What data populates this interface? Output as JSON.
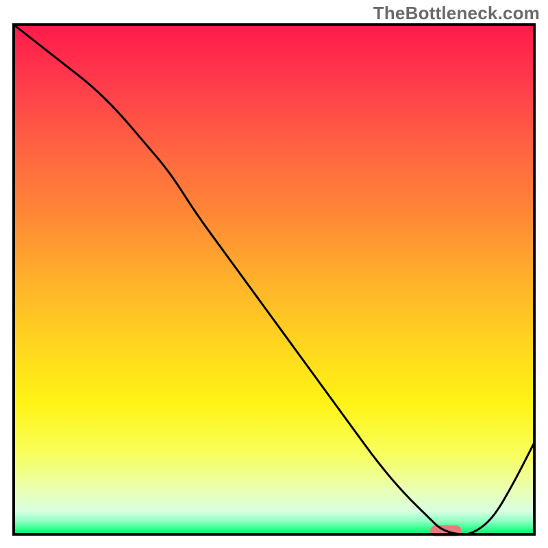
{
  "watermark": "TheBottleneck.com",
  "chart_data": {
    "type": "line",
    "title": "",
    "xlabel": "",
    "ylabel": "",
    "xlim": [
      0,
      100
    ],
    "ylim": [
      0,
      100
    ],
    "series": [
      {
        "name": "bottleneck-curve",
        "x": [
          0,
          5,
          10,
          15,
          20,
          25,
          30,
          35,
          40,
          45,
          50,
          55,
          60,
          65,
          70,
          75,
          80,
          82,
          85,
          88,
          92,
          96,
          100
        ],
        "values": [
          100,
          96,
          92,
          88,
          83,
          77,
          71,
          63,
          56,
          49,
          42,
          35,
          28,
          21,
          14,
          8,
          3,
          1,
          0,
          0,
          3,
          10,
          18
        ]
      }
    ],
    "marker": {
      "x_start": 80,
      "x_end": 86,
      "y": 0,
      "color": "#e67a7d"
    },
    "gradient_stops": [
      {
        "offset": 0.0,
        "color": "#ff1a4b"
      },
      {
        "offset": 0.12,
        "color": "#ff3d4b"
      },
      {
        "offset": 0.25,
        "color": "#ff6640"
      },
      {
        "offset": 0.38,
        "color": "#ff8a35"
      },
      {
        "offset": 0.5,
        "color": "#ffb12a"
      },
      {
        "offset": 0.62,
        "color": "#ffd31f"
      },
      {
        "offset": 0.74,
        "color": "#fff314"
      },
      {
        "offset": 0.84,
        "color": "#f7ff5a"
      },
      {
        "offset": 0.91,
        "color": "#eaffb0"
      },
      {
        "offset": 0.955,
        "color": "#d8ffe2"
      },
      {
        "offset": 0.975,
        "color": "#8affc0"
      },
      {
        "offset": 0.99,
        "color": "#2cff8b"
      },
      {
        "offset": 1.0,
        "color": "#08e66a"
      }
    ],
    "border_color": "#000000",
    "curve_color": "#000000",
    "curve_width": 3
  }
}
